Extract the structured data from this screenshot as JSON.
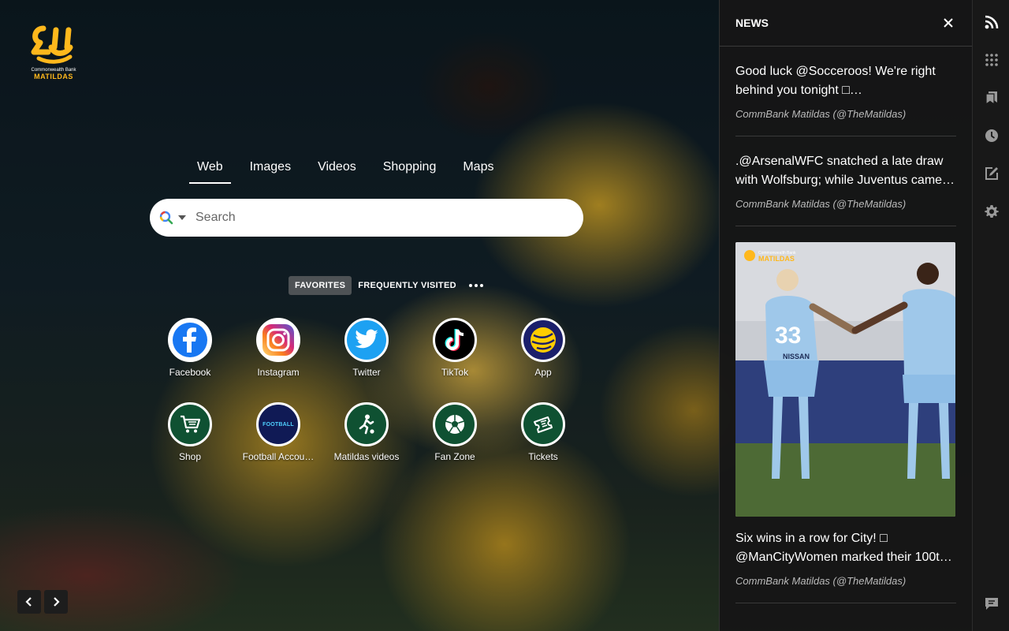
{
  "logo": {
    "line1": "Commonwealth Bank",
    "line2": "MATILDAS"
  },
  "search": {
    "tabs": [
      "Web",
      "Images",
      "Videos",
      "Shopping",
      "Maps"
    ],
    "placeholder": "Search"
  },
  "speed_dial": {
    "header_tabs": [
      "FAVORITES",
      "FREQUENTLY VISITED"
    ],
    "items": [
      {
        "label": "Facebook",
        "icon": "facebook-icon"
      },
      {
        "label": "Instagram",
        "icon": "instagram-icon"
      },
      {
        "label": "Twitter",
        "icon": "twitter-icon"
      },
      {
        "label": "TikTok",
        "icon": "tiktok-icon"
      },
      {
        "label": "App",
        "icon": "football-app-icon"
      },
      {
        "label": "Shop",
        "icon": "shopping-cart-icon"
      },
      {
        "label": "Football Accou…",
        "icon": "football-logo-icon",
        "badge": "FOOTBALL"
      },
      {
        "label": "Matildas videos",
        "icon": "player-kicking-icon"
      },
      {
        "label": "Fan Zone",
        "icon": "soccer-ball-icon"
      },
      {
        "label": "Tickets",
        "icon": "ticket-icon"
      }
    ]
  },
  "news": {
    "title": "NEWS",
    "articles": [
      {
        "title": "Good luck @Socceroos! We're right behind you tonight □…",
        "source": "CommBank Matildas (@TheMatildas)"
      },
      {
        "title": ".@ArsenalWFC snatched a late draw with Wolfsburg; while Juventus came…",
        "source": "CommBank Matildas (@TheMatildas)"
      },
      {
        "title": "Six wins in a row for City! □ @ManCityWomen marked their 100t…",
        "source": "CommBank Matildas (@TheMatildas)",
        "image": {
          "logo_line1": "Commonwealth Bank",
          "logo_line2": "MATILDAS",
          "player_number": "33",
          "shirt_text": "NISSAN"
        }
      }
    ]
  },
  "sidebar_icons": [
    "rss-icon",
    "apps-grid-icon",
    "bookmarks-icon",
    "history-icon",
    "notes-icon",
    "settings-icon",
    "feedback-icon"
  ],
  "colors": {
    "brand_gold": "#ffb81c",
    "brand_green": "#00843d",
    "panel_bg": "#161616"
  }
}
